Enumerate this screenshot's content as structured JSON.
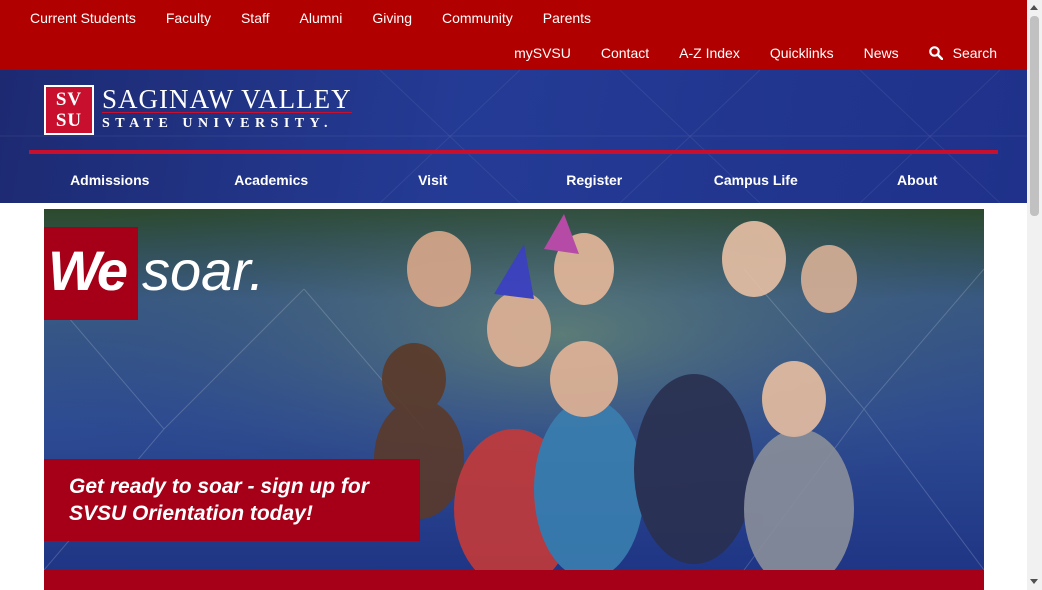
{
  "utility_nav": {
    "row1": [
      "Current Students",
      "Faculty",
      "Staff",
      "Alumni",
      "Giving",
      "Community",
      "Parents"
    ],
    "row2": [
      "mySVSU",
      "Contact",
      "A-Z Index",
      "Quicklinks",
      "News"
    ],
    "search_label": "Search"
  },
  "logo": {
    "mark_top": "SV",
    "mark_bottom": "SU",
    "line1": "SAGINAW VALLEY",
    "line2": "STATE UNIVERSITY."
  },
  "main_nav": [
    "Admissions",
    "Academics",
    "Visit",
    "Register",
    "Campus Life",
    "About"
  ],
  "hero": {
    "tagline_bold": "We",
    "tagline_rest": "soar.",
    "callout_line1": "Get ready to soar - sign up for",
    "callout_line2": "SVSU Orientation today!"
  },
  "colors": {
    "utility_red": "#b00000",
    "brand_red": "#c8102e",
    "navy": "#1f318a"
  }
}
